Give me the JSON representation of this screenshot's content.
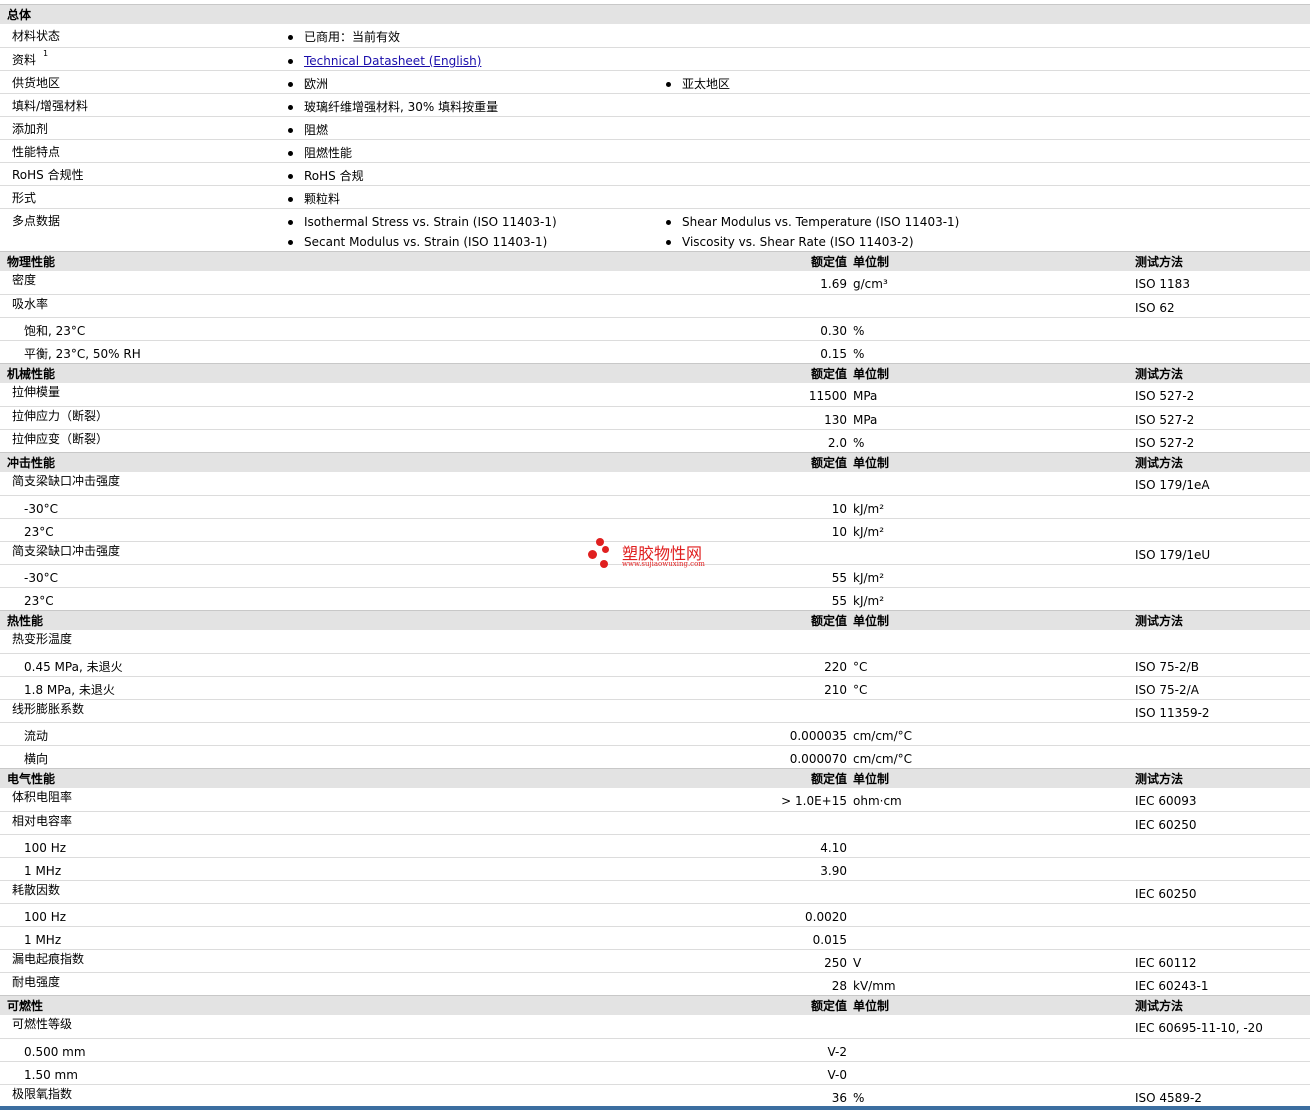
{
  "general": {
    "title": "总体",
    "rows": [
      {
        "label": "材料状态",
        "items": [
          "已商用：当前有效"
        ]
      },
      {
        "label": "资料",
        "sup": "1",
        "items": [
          "Technical Datasheet (English)"
        ]
      },
      {
        "label": "供货地区",
        "items": [
          "欧洲",
          "亚太地区"
        ]
      },
      {
        "label": "填料/增强材料",
        "items": [
          "玻璃纤维增强材料, 30% 填料按重量"
        ]
      },
      {
        "label": "添加剂",
        "items": [
          "阻燃"
        ]
      },
      {
        "label": "性能特点",
        "items": [
          "阻燃性能"
        ]
      },
      {
        "label": "RoHS 合规性",
        "items": [
          "RoHS 合规"
        ]
      },
      {
        "label": "形式",
        "items": [
          "颗粒料"
        ]
      },
      {
        "label": "多点数据",
        "items": [
          "Isothermal Stress vs. Strain (ISO 11403-1)",
          "Shear Modulus vs. Temperature (ISO 11403-1)",
          "Secant Modulus vs. Strain (ISO 11403-1)",
          "Viscosity vs. Shear Rate (ISO 11403-2)"
        ]
      }
    ]
  },
  "columns": {
    "value": "额定值",
    "unit": "单位制",
    "method": "测试方法"
  },
  "sections": [
    {
      "title": "物理性能",
      "rows": [
        {
          "label": "密度",
          "value": "1.69",
          "unit": "g/cm³",
          "method": "ISO 1183"
        },
        {
          "label": "吸水率",
          "method": "ISO 62"
        },
        {
          "label": "饱和, 23°C",
          "indent": true,
          "value": "0.30",
          "unit": "%"
        },
        {
          "label": "平衡, 23°C, 50% RH",
          "indent": true,
          "value": "0.15",
          "unit": "%"
        }
      ]
    },
    {
      "title": "机械性能",
      "rows": [
        {
          "label": "拉伸模量",
          "value": "11500",
          "unit": "MPa",
          "method": "ISO 527-2"
        },
        {
          "label": "拉伸应力（断裂）",
          "value": "130",
          "unit": "MPa",
          "method": "ISO 527-2"
        },
        {
          "label": "拉伸应变（断裂）",
          "value": "2.0",
          "unit": "%",
          "method": "ISO 527-2"
        }
      ]
    },
    {
      "title": "冲击性能",
      "rows": [
        {
          "label": "简支梁缺口冲击强度",
          "method": "ISO 179/1eA"
        },
        {
          "label": "-30°C",
          "indent": true,
          "value": "10",
          "unit": "kJ/m²"
        },
        {
          "label": "23°C",
          "indent": true,
          "value": "10",
          "unit": "kJ/m²"
        },
        {
          "label": "简支梁缺口冲击强度",
          "method": "ISO 179/1eU"
        },
        {
          "label": "-30°C",
          "indent": true,
          "value": "55",
          "unit": "kJ/m²"
        },
        {
          "label": "23°C",
          "indent": true,
          "value": "55",
          "unit": "kJ/m²"
        }
      ]
    },
    {
      "title": "热性能",
      "rows": [
        {
          "label": "热变形温度"
        },
        {
          "label": "0.45 MPa, 未退火",
          "indent": true,
          "value": "220",
          "unit": "°C",
          "method": "ISO 75-2/B"
        },
        {
          "label": "1.8 MPa, 未退火",
          "indent": true,
          "value": "210",
          "unit": "°C",
          "method": "ISO 75-2/A"
        },
        {
          "label": "线形膨胀系数",
          "method": "ISO 11359-2"
        },
        {
          "label": "流动",
          "indent": true,
          "value": "0.000035",
          "unit": "cm/cm/°C"
        },
        {
          "label": "横向",
          "indent": true,
          "value": "0.000070",
          "unit": "cm/cm/°C"
        }
      ]
    },
    {
      "title": "电气性能",
      "rows": [
        {
          "label": "体积电阻率",
          "value": "> 1.0E+15",
          "unit": "ohm·cm",
          "method": "IEC 60093"
        },
        {
          "label": "相对电容率",
          "method": "IEC 60250"
        },
        {
          "label": "100 Hz",
          "indent": true,
          "value": "4.10"
        },
        {
          "label": "1 MHz",
          "indent": true,
          "value": "3.90"
        },
        {
          "label": "耗散因数",
          "method": "IEC 60250"
        },
        {
          "label": "100 Hz",
          "indent": true,
          "value": "0.0020"
        },
        {
          "label": "1 MHz",
          "indent": true,
          "value": "0.015"
        },
        {
          "label": "漏电起痕指数",
          "value": "250",
          "unit": "V",
          "method": "IEC 60112"
        },
        {
          "label": "耐电强度",
          "value": "28",
          "unit": "kV/mm",
          "method": "IEC 60243-1"
        }
      ]
    },
    {
      "title": "可燃性",
      "rows": [
        {
          "label": "可燃性等级",
          "method": "IEC 60695-11-10, -20"
        },
        {
          "label": "0.500 mm",
          "indent": true,
          "value": "V-2"
        },
        {
          "label": "1.50 mm",
          "indent": true,
          "value": "V-0"
        },
        {
          "label": "极限氧指数",
          "value": "36",
          "unit": "%",
          "method": "ISO 4589-2"
        }
      ]
    }
  ],
  "watermark": {
    "name": "塑胶物性网",
    "url": "www.sujiaowuxing.com"
  }
}
